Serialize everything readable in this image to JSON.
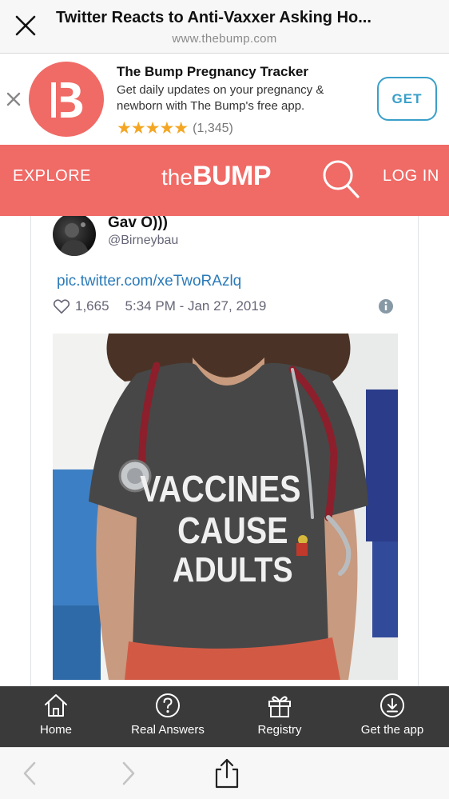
{
  "browser": {
    "page_title": "Twitter Reacts to Anti-Vaxxer Asking Ho...",
    "url": "www.thebump.com"
  },
  "app_banner": {
    "logo_letter": "B",
    "app_name": "The Bump Pregnancy Tracker",
    "description": "Get daily updates on your pregnancy & newborn with The Bump's free app.",
    "stars": "★★★★★",
    "rating_value": 5,
    "rating_count": "(1,345)",
    "cta_label": "GET",
    "accent_color": "#3a9fc9",
    "logo_color": "#f06a66"
  },
  "site_nav": {
    "explore_label": "EXPLORE",
    "brand_the": "the",
    "brand_bump": "BUMP",
    "login_label": "LOG IN",
    "background_color": "#f06a66"
  },
  "tweet": {
    "author_name": "Gav O)))",
    "author_handle": "@Birneybau",
    "link_text": "pic.twitter.com/xeTwoRAzlq",
    "like_count": "1,665",
    "timestamp": "5:34 PM - Jan 27, 2019",
    "shirt_lines": [
      "VACCINES",
      "CAUSE",
      "ADULTS"
    ]
  },
  "tabbar": {
    "items": [
      {
        "label": "Home",
        "icon": "home-icon"
      },
      {
        "label": "Real Answers",
        "icon": "question-circle-icon"
      },
      {
        "label": "Registry",
        "icon": "gift-icon"
      },
      {
        "label": "Get the app",
        "icon": "download-circle-icon"
      }
    ]
  },
  "toolbar": {
    "icons": [
      "back-arrow-icon",
      "forward-arrow-icon",
      "share-icon"
    ]
  }
}
